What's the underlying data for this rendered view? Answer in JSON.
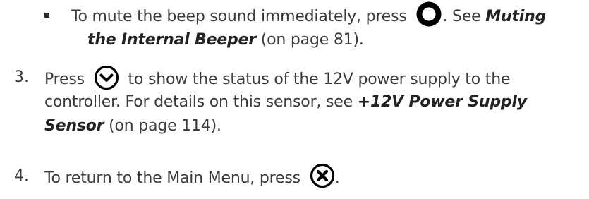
{
  "bullet": {
    "text_before": "To mute the beep sound immediately, press",
    "text_after": ". See",
    "link_part1": "Muting",
    "link_part2": "the Internal Beeper",
    "page_ref": "(on page 81)."
  },
  "step3": {
    "number": "3.",
    "text_press": "Press",
    "text_rest1": "to show the status of the 12V power supply to the",
    "text_line2": "controller. For details on this sensor, see",
    "link_part1": "+12V Power Supply",
    "link_part2": "Sensor",
    "page_ref": "(on page 114)."
  },
  "step4": {
    "number": "4.",
    "text": "To return to the Main Menu, press",
    "text_after": "."
  },
  "icons": {
    "ok": "circle-button-icon",
    "down": "chevron-down-circle-icon",
    "cancel": "x-circle-icon"
  }
}
